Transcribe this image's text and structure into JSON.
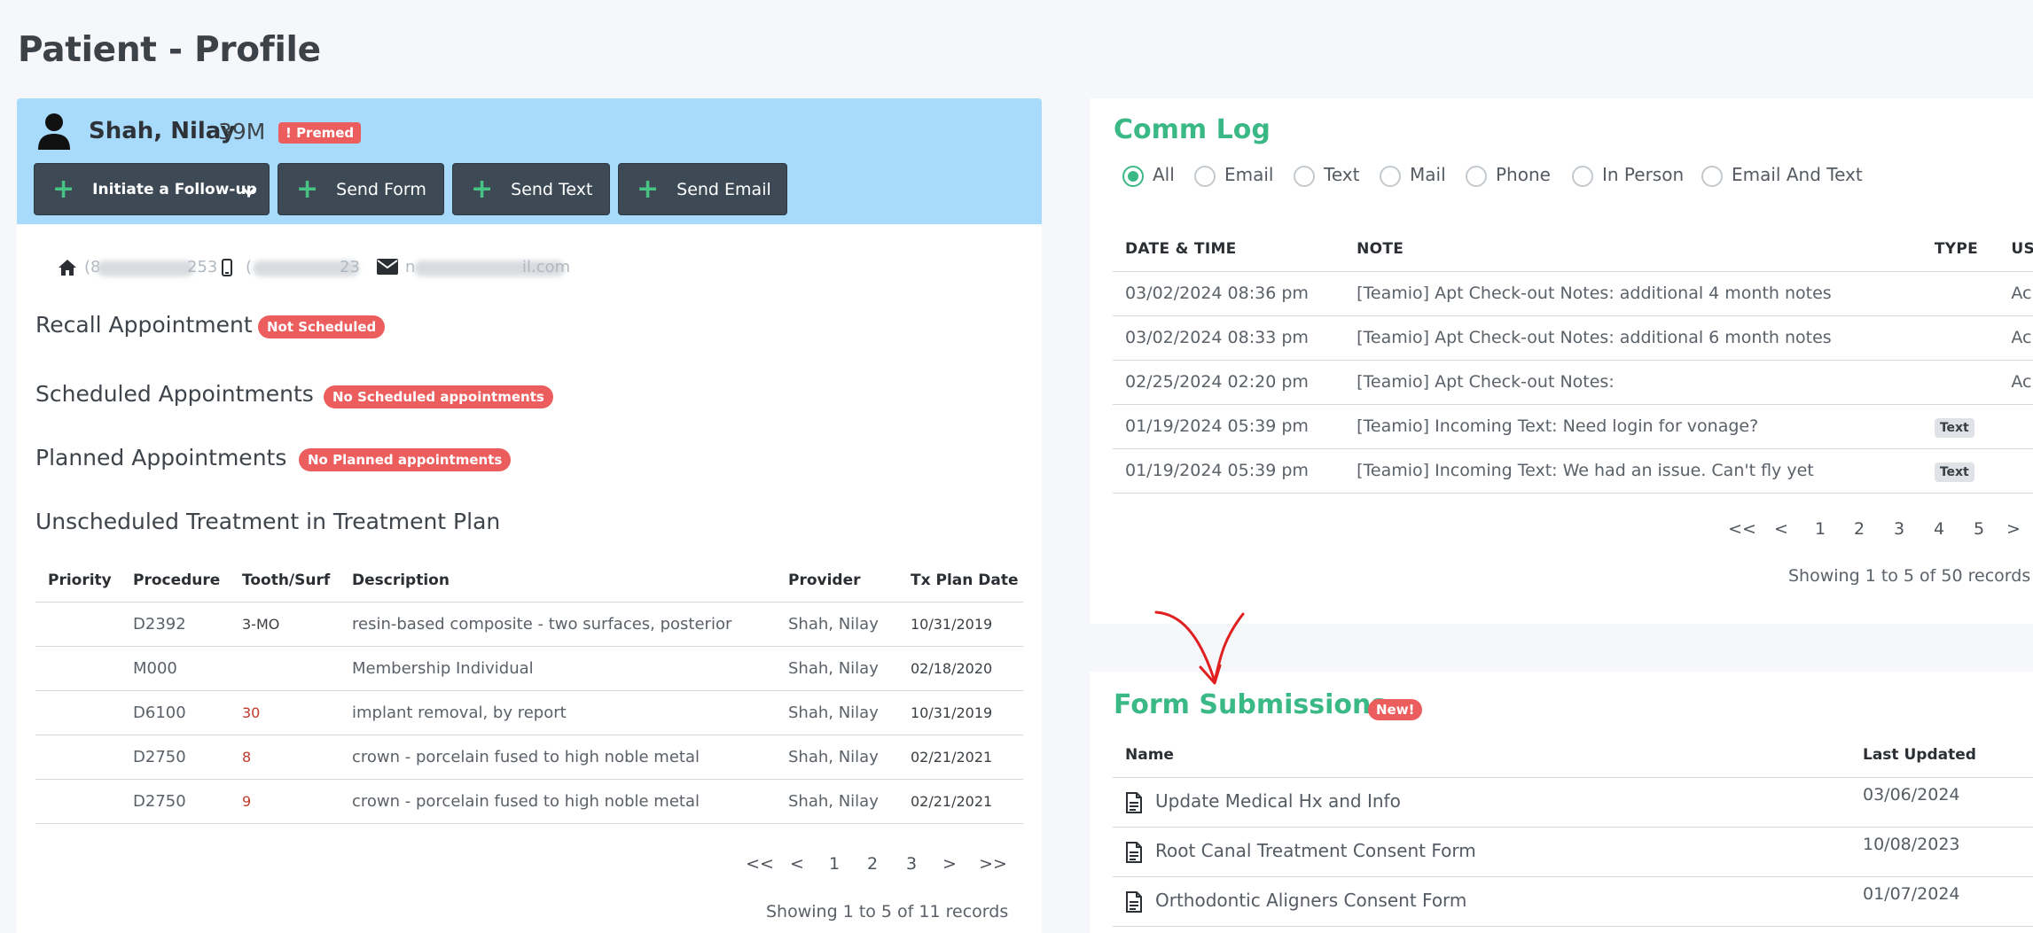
{
  "page": {
    "title": "Patient - Profile"
  },
  "patient": {
    "name": "Shah, Nilay",
    "age_sex": "39M",
    "premed_badge": "! Premed",
    "actions": [
      "Initiate a Follow-up",
      "Send Form",
      "Send Text",
      "Send Email"
    ]
  },
  "contact": {
    "home_phone": "(8",
    "home_phone_tail": "253",
    "cell_phone": "(",
    "cell_phone_tail": "23",
    "email": "n",
    "email_tail": "il.com"
  },
  "sections": {
    "recall": {
      "title": "Recall Appointment",
      "badge": "Not Scheduled"
    },
    "scheduled": {
      "title": "Scheduled Appointments",
      "badge": "No Scheduled appointments"
    },
    "planned": {
      "title": "Planned Appointments",
      "badge": "No Planned appointments"
    },
    "unscheduled": {
      "title": "Unscheduled Treatment in Treatment Plan"
    }
  },
  "treatment_table": {
    "columns": [
      "Priority",
      "Procedure",
      "Tooth/Surf",
      "Description",
      "Provider",
      "Tx Plan Date"
    ],
    "rows": [
      {
        "priority": "",
        "procedure": "D2392",
        "tooth": "3-MO",
        "description": "resin-based composite - two surfaces, posterior",
        "provider": "Shah, Nilay",
        "date": "10/31/2019"
      },
      {
        "priority": "",
        "procedure": "M000",
        "tooth": "",
        "description": "Membership Individual",
        "provider": "Shah, Nilay",
        "date": "02/18/2020"
      },
      {
        "priority": "",
        "procedure": "D6100",
        "tooth": "30",
        "description": "implant removal, by report",
        "provider": "Shah, Nilay",
        "date": "10/31/2019"
      },
      {
        "priority": "",
        "procedure": "D2750",
        "tooth": "8",
        "description": "crown - porcelain fused to high noble metal",
        "provider": "Shah, Nilay",
        "date": "02/21/2021"
      },
      {
        "priority": "",
        "procedure": "D2750",
        "tooth": "9",
        "description": "crown - porcelain fused to high noble metal",
        "provider": "Shah, Nilay",
        "date": "02/21/2021"
      }
    ],
    "pager": [
      "<<",
      "<",
      "1",
      "2",
      "3",
      ">",
      ">>"
    ],
    "records": "Showing 1 to 5 of 11 records"
  },
  "comm_log": {
    "title": "Comm Log",
    "filters": [
      "All",
      "Email",
      "Text",
      "Mail",
      "Phone",
      "In Person",
      "Email And Text"
    ],
    "selected_filter": "All",
    "columns": [
      "DATE & TIME",
      "NOTE",
      "TYPE",
      "US"
    ],
    "rows": [
      {
        "datetime": "03/02/2024 08:36 pm",
        "note": "[Teamio] Apt Check-out Notes: additional 4 month notes",
        "type": "",
        "user": "Ac"
      },
      {
        "datetime": "03/02/2024 08:33 pm",
        "note": "[Teamio] Apt Check-out Notes: additional 6 month notes",
        "type": "",
        "user": "Ac"
      },
      {
        "datetime": "02/25/2024 02:20 pm",
        "note": "[Teamio] Apt Check-out Notes:",
        "type": "",
        "user": "Ac"
      },
      {
        "datetime": "01/19/2024 05:39 pm",
        "note": "[Teamio] Incoming Text: Need login for vonage?",
        "type": "Text",
        "user": ""
      },
      {
        "datetime": "01/19/2024 05:39 pm",
        "note": "[Teamio] Incoming Text: We had an issue. Can't fly yet",
        "type": "Text",
        "user": ""
      }
    ],
    "pager": [
      "<<",
      "<",
      "1",
      "2",
      "3",
      "4",
      "5",
      ">"
    ],
    "records": "Showing 1 to 5 of 50 records"
  },
  "form_submissions": {
    "title": "Form Submissions",
    "badge": "New!",
    "columns": [
      "Name",
      "Last Updated"
    ],
    "rows": [
      {
        "name": "Update Medical Hx and Info",
        "updated": "03/06/2024"
      },
      {
        "name": "Root Canal Treatment Consent Form",
        "updated": "10/08/2023"
      },
      {
        "name": "Orthodontic Aligners Consent Form",
        "updated": "01/07/2024"
      }
    ]
  },
  "colors": {
    "accent_green": "#3ab886",
    "badge_red": "#ec5e5e",
    "header_blue": "#a8dbfb",
    "button_dark": "#3d4a55",
    "annotation_red": "#e02020"
  }
}
